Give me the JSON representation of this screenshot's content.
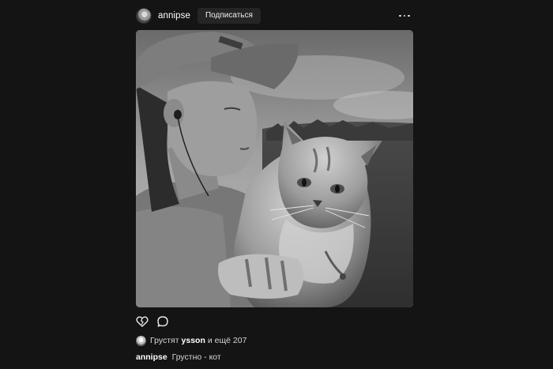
{
  "post": {
    "username": "annipse",
    "subscribe_label": "Подписаться",
    "liked_prefix": "Грустят",
    "liked_by": "ysson",
    "liked_suffix": "и ещё 207",
    "caption_author": "annipse",
    "caption_text": "Грустно - кот"
  },
  "icons": {
    "more": "more-horizontal-icon",
    "like": "broken-heart-icon",
    "comment": "comment-bubble-icon"
  },
  "colors": {
    "background": "#141414",
    "button": "#252525",
    "text": "#ffffff"
  }
}
